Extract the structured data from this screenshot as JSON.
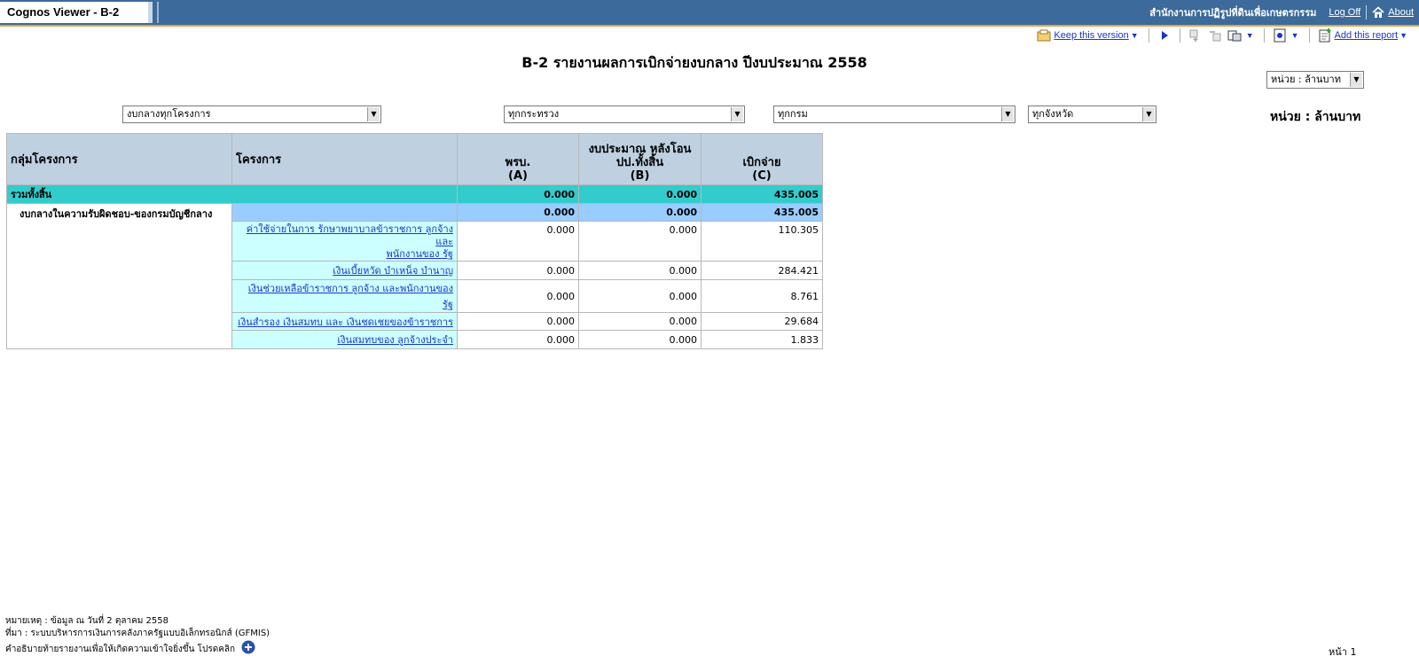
{
  "app": {
    "title": "Cognos Viewer - B-2",
    "organization": "สำนักงานการปฏิรูปที่ดินเพื่อเกษตรกรรม",
    "logoff_label": "Log Off",
    "about_label": "About"
  },
  "toolbar": {
    "keep_version_label": "Keep this version",
    "add_report_label": "Add this report"
  },
  "report": {
    "title": "B-2 รายงานผลการเบิกจ่ายงบกลาง ปีงบประมาณ 2558",
    "unit_select_value": "หน่วย : ล้านบาท",
    "unit_label": "หน่วย : ล้านบาท"
  },
  "filters": {
    "program": "งบกลางทุกโครงการ",
    "ministry": "ทุกกระทรวง",
    "department": "ทุกกรม",
    "province": "ทุกจังหวัด"
  },
  "table": {
    "headers": {
      "group": "กลุ่มโครงการ",
      "project": "โครงการ",
      "a_line1": "พรบ.",
      "a_line2": "(A)",
      "b_line1": "งบประมาณ หลังโอน",
      "b_line2": "ปป.ทั้งสิ้น",
      "b_line3": "(B)",
      "c_line1": "เบิกจ่าย",
      "c_line2": "(C)"
    },
    "total": {
      "label": "รวมทั้งสิ้น",
      "a": "0.000",
      "b": "0.000",
      "c": "435.005"
    },
    "department": {
      "label": "งบกลางในความรับผิดชอบ-ของกรมบัญชีกลาง",
      "a": "0.000",
      "b": "0.000",
      "c": "435.005"
    },
    "rows": [
      {
        "line1": "ค่าใช้จ่ายในการ รักษาพยาบาลข้าราชการ ลูกจ้าง และ",
        "line2": "พนักงานของ รัฐ",
        "a": "0.000",
        "b": "0.000",
        "c": "110.305"
      },
      {
        "line1": "เงินเบี้ยหวัด บำเหน็จ บำนาญ",
        "line2": "",
        "a": "0.000",
        "b": "0.000",
        "c": "284.421"
      },
      {
        "line1": "เงินช่วยเหลือข้าราชการ ลูกจ้าง และพนักงานของ รัฐ",
        "line2": "",
        "a": "0.000",
        "b": "0.000",
        "c": "8.761"
      },
      {
        "line1": "เงินสำรอง เงินสมทบ และ เงินชดเชยของข้าราชการ",
        "line2": "",
        "a": "0.000",
        "b": "0.000",
        "c": "29.684"
      },
      {
        "line1": "เงินสมทบของ ลูกจ้างประจำ",
        "line2": "",
        "a": "0.000",
        "b": "0.000",
        "c": "1.833"
      }
    ]
  },
  "footer": {
    "note": "หมายเหตุ :   ข้อมูล ณ วันที่ 2  ตุลาคม 2558",
    "source": "ที่มา : ระบบบริหารการเงินการคลังภาครัฐแบบอิเล็กทรอนิกส์ (GFMIS)",
    "explain": "คำอธิบายท้ายรายงานเพื่อให้เกิดความเข้าใจยิ่งขึ้น โปรดคลิก",
    "page": "หน้า 1"
  },
  "colors": {
    "titlebar": "#3b6a9b",
    "header": "#bfd1e1",
    "total": "#32cccc",
    "department": "#99ccff",
    "project": "#ccffff",
    "link": "#1a38c8"
  },
  "icons": [
    "home-icon",
    "keep-version-icon",
    "run-icon",
    "drill-down-icon",
    "drill-up-icon",
    "related-links-icon",
    "view-format-icon",
    "add-report-icon",
    "plus-circle-icon"
  ]
}
